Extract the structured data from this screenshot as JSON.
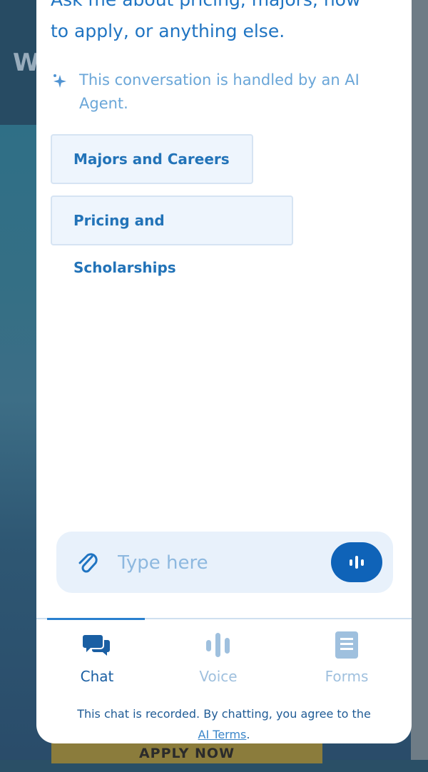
{
  "intro": {
    "line1": "Ask me about pricing, majors, how",
    "line2": "to apply, or anything else."
  },
  "ai_notice": "This conversation is handled by an AI Agent.",
  "suggestions": [
    {
      "label": "Majors and Careers"
    },
    {
      "label": "Pricing and Scholarships"
    }
  ],
  "composer": {
    "placeholder": "Type here",
    "attach_icon": "paperclip-icon",
    "voice_icon": "voice-wave-icon"
  },
  "tabs": [
    {
      "label": "Chat",
      "icon": "chat-bubbles-icon",
      "active": true
    },
    {
      "label": "Voice",
      "icon": "voice-bars-icon",
      "active": false
    },
    {
      "label": "Forms",
      "icon": "document-icon",
      "active": false
    }
  ],
  "footer": {
    "text": "This chat is recorded. By chatting, you agree to the",
    "link": "AI Terms",
    "end": "."
  },
  "background": {
    "cta": "APPLY NOW"
  },
  "colors": {
    "accent": "#0f63b8",
    "link_text": "#1f74c2",
    "chip_bg": "#eef5fd",
    "composer_bg": "#e8f1fb"
  }
}
